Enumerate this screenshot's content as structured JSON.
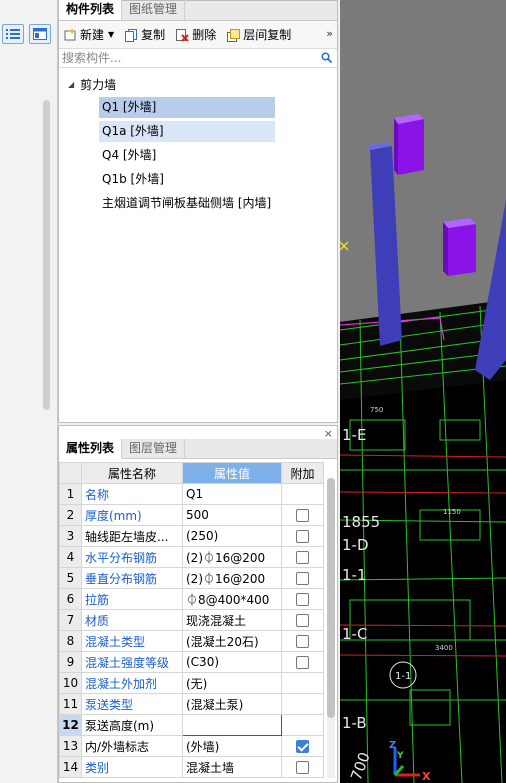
{
  "component_panel": {
    "tabs": [
      "构件列表",
      "图纸管理"
    ],
    "toolbar": {
      "new_label": "新建",
      "copy_label": "复制",
      "delete_label": "删除",
      "layer_copy_label": "层间复制",
      "more_glyph": "»"
    },
    "search_placeholder": "搜索构件...",
    "tree": {
      "root_label": "剪力墙",
      "items": [
        "Q1 [外墙]",
        "Q1a [外墙]",
        "Q4 [外墙]",
        "Q1b [外墙]",
        "主烟道调节闸板基础侧墙 [内墙]"
      ]
    }
  },
  "property_panel": {
    "close_glyph": "×",
    "tabs": [
      "属性列表",
      "图层管理"
    ],
    "columns": [
      "",
      "属性名称",
      "属性值",
      "附加"
    ],
    "rows": [
      {
        "idx": "1",
        "name": "名称",
        "value": "Q1",
        "name_blue": true,
        "checkbox": null
      },
      {
        "idx": "2",
        "name": "厚度(mm)",
        "value": "500",
        "name_blue": true,
        "checkbox": false
      },
      {
        "idx": "3",
        "name": "轴线距左墙皮...",
        "value": "(250)",
        "name_blue": false,
        "checkbox": false
      },
      {
        "idx": "4",
        "name": "水平分布钢筋",
        "value": "(2)⏀16@200",
        "name_blue": true,
        "checkbox": false
      },
      {
        "idx": "5",
        "name": "垂直分布钢筋",
        "value": "(2)⏀16@200",
        "name_blue": true,
        "checkbox": false
      },
      {
        "idx": "6",
        "name": "拉筋",
        "value": "⏀8@400*400",
        "name_blue": true,
        "checkbox": false
      },
      {
        "idx": "7",
        "name": "材质",
        "value": "现浇混凝土",
        "name_blue": true,
        "checkbox": false
      },
      {
        "idx": "8",
        "name": "混凝土类型",
        "value": "(混凝土20石)",
        "name_blue": true,
        "checkbox": false
      },
      {
        "idx": "9",
        "name": "混凝土强度等级",
        "value": "(C30)",
        "name_blue": true,
        "checkbox": false
      },
      {
        "idx": "10",
        "name": "混凝土外加剂",
        "value": "(无)",
        "name_blue": true,
        "checkbox": null
      },
      {
        "idx": "11",
        "name": "泵送类型",
        "value": "(混凝土泵)",
        "name_blue": true,
        "checkbox": null
      },
      {
        "idx": "12",
        "name": "泵送高度(m)",
        "value": "",
        "name_blue": false,
        "checkbox": null
      },
      {
        "idx": "13",
        "name": "内/外墙标志",
        "value": "(外墙)",
        "name_blue": false,
        "checkbox": true
      },
      {
        "idx": "14",
        "name": "类别",
        "value": "混凝土墙",
        "name_blue": true,
        "checkbox": false
      }
    ]
  },
  "viewport": {
    "axis_labels": [
      "1-E",
      "1855",
      "1-D",
      "1-1",
      "1-C",
      "1-B",
      "700",
      "1-1"
    ],
    "axis_x": "X",
    "axis_y": "Y",
    "axis_z": "Z",
    "dimension_labels": [
      "1150",
      "3400",
      "750"
    ],
    "colors": {
      "background": "#000000",
      "sky": "#7a7a7a",
      "column_blue": "#3e3eb8",
      "column_purple": "#8a14e8",
      "grid_green": "#27c427",
      "grid_red": "#d82020",
      "magenta": "#e030e0"
    }
  }
}
